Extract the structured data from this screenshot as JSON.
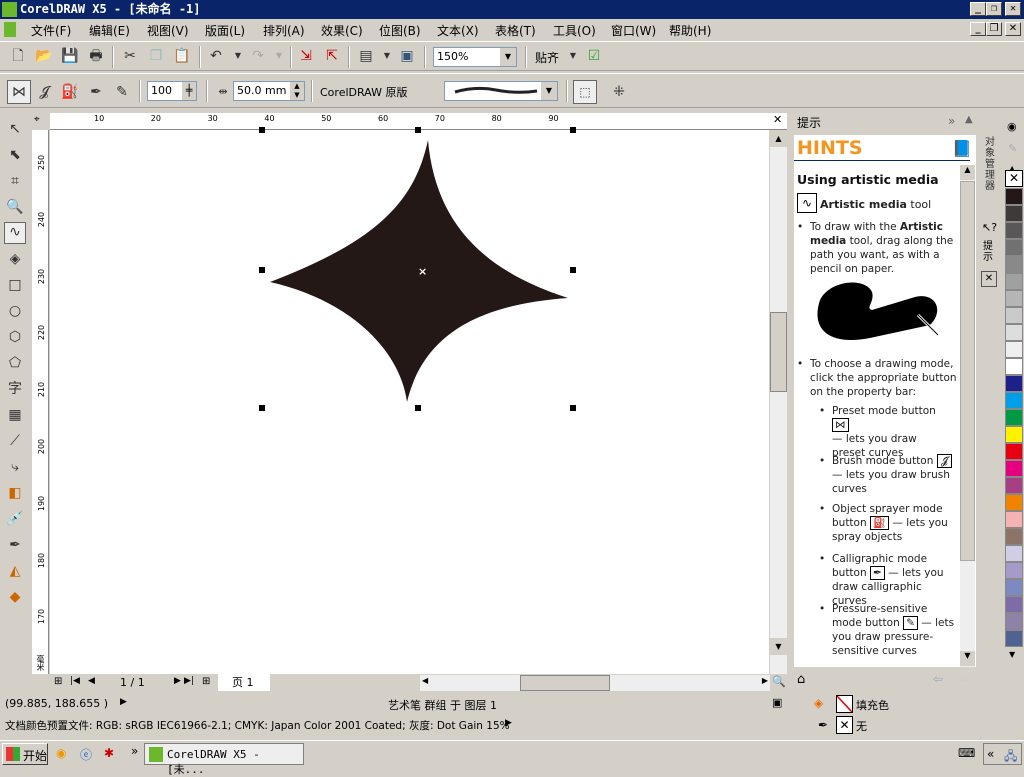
{
  "window": {
    "title": "CorelDRAW X5 - [未命名 -1]"
  },
  "menu": [
    "文件(F)",
    "编辑(E)",
    "视图(V)",
    "版面(L)",
    "排列(A)",
    "效果(C)",
    "位图(B)",
    "文本(X)",
    "表格(T)",
    "工具(O)",
    "窗口(W)",
    "帮助(H)"
  ],
  "toolbar": {
    "zoom": "150%",
    "snap_label": "贴齐"
  },
  "property_bar": {
    "smoothing": "100",
    "stroke_width": "50.0 mm",
    "preset_label": "CorelDRAW 原版"
  },
  "rulers": {
    "top": [
      "10",
      "20",
      "30",
      "40",
      "50",
      "60",
      "70",
      "80",
      "90"
    ],
    "left": [
      "250",
      "240",
      "230",
      "220",
      "210",
      "200",
      "190",
      "180",
      "170"
    ],
    "unit": "毫米"
  },
  "page_nav": {
    "counter": "1 / 1",
    "tab": "页 1"
  },
  "hints": {
    "panel_title": "提示",
    "header": "HINTS",
    "heading": "Using artistic media",
    "tool_name_bold": "Artistic media",
    "tool_name_rest": " tool",
    "p1": [
      "To draw with the ",
      "Artistic media",
      " tool, drag along the path you want, as with a pencil on paper."
    ],
    "p2": "To choose a drawing mode, click the appropriate button on the property bar:",
    "modes": [
      {
        "a": "Preset mode button",
        "b": "— lets you draw preset curves"
      },
      {
        "a": "Brush mode button",
        "b": "— lets you draw brush curves"
      },
      {
        "a": "Object sprayer mode button",
        "b": "— lets you spray objects"
      },
      {
        "a": "Calligraphic mode button",
        "b": "— lets you draw calligraphic curves"
      },
      {
        "a": "Pressure-sensitive mode button",
        "b": "— lets you draw pressure-sensitive curves"
      }
    ],
    "side_tabs": [
      "对象管理器",
      "提示"
    ]
  },
  "palette": [
    "#231815",
    "#3e3a39",
    "#595757",
    "#727171",
    "#898989",
    "#9fa0a0",
    "#b5b5b6",
    "#c9caca",
    "#dcdddd",
    "#efefef",
    "#ffffff",
    "#1d2088",
    "#00a0e9",
    "#009944",
    "#fff100",
    "#e60012",
    "#e4007f",
    "#a63f83",
    "#f08300",
    "#f5b2b2",
    "#8c7468",
    "#d0cde5",
    "#a59aca",
    "#7d8ac2",
    "#7e6ca8",
    "#8e82a9",
    "#4f6291"
  ],
  "shape_fill": "#231815",
  "status": {
    "coords": "(99.885, 188.655 )",
    "selection": "艺术笔 群组 于 图层 1",
    "profile": "文档颜色预置文件: RGB: sRGB IEC61966-2.1; CMYK: Japan Color 2001 Coated; 灰度: Dot Gain 15%",
    "fill_label": "填充色",
    "outline_label": "无"
  },
  "taskbar": {
    "start": "开始",
    "task": "CorelDRAW X5 - [未..."
  }
}
